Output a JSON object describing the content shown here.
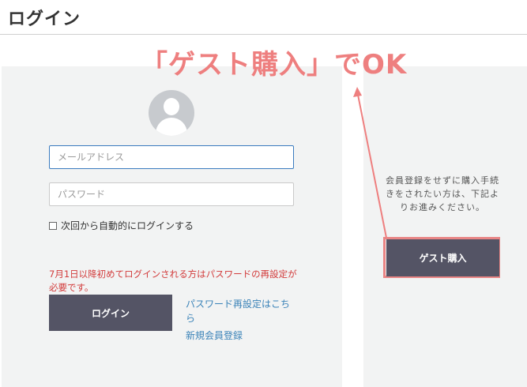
{
  "page": {
    "title": "ログイン"
  },
  "login": {
    "email_placeholder": "メールアドレス",
    "password_placeholder": "パスワード",
    "remember_label": "次回から自動的にログインする",
    "notice": "7月1日以降初めてログインされる方はパスワードの再設定が必要です。",
    "login_button": "ログイン",
    "reset_link": "パスワード再設定はこちら",
    "register_link": "新規会員登録"
  },
  "guest": {
    "description": "会員登録をせずに購入手続きをされたい方は、下記よりお進みください。",
    "button": "ゲスト購入"
  },
  "annotation": {
    "text": "「ゲスト購入」でOK",
    "color": "#ee7f7f"
  },
  "colors": {
    "button_bg": "#545465",
    "notice": "#d23b3b",
    "link": "#3b83b8",
    "panel_bg": "#f2f3f3"
  }
}
